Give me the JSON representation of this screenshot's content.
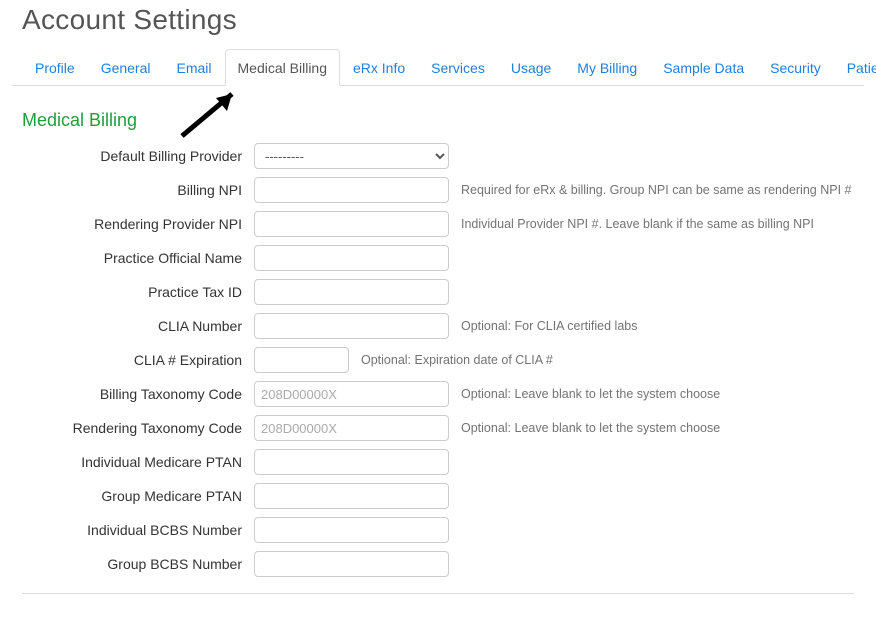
{
  "header": {
    "title": "Account Settings"
  },
  "tabs": [
    {
      "label": "Profile",
      "active": false
    },
    {
      "label": "General",
      "active": false
    },
    {
      "label": "Email",
      "active": false
    },
    {
      "label": "Medical Billing",
      "active": true
    },
    {
      "label": "eRx Info",
      "active": false
    },
    {
      "label": "Services",
      "active": false
    },
    {
      "label": "Usage",
      "active": false
    },
    {
      "label": "My Billing",
      "active": false
    },
    {
      "label": "Sample Data",
      "active": false
    },
    {
      "label": "Security",
      "active": false
    },
    {
      "label": "Patient Payments",
      "active": false
    }
  ],
  "section": {
    "title": "Medical Billing"
  },
  "form": {
    "default_billing_provider": {
      "label": "Default Billing Provider",
      "selected": "---------"
    },
    "billing_npi": {
      "label": "Billing NPI",
      "value": "",
      "help": "Required for eRx & billing. Group NPI can be same as rendering NPI #"
    },
    "rendering_provider_npi": {
      "label": "Rendering Provider NPI",
      "value": "",
      "help": "Individual Provider NPI #. Leave blank if the same as billing NPI"
    },
    "practice_official_name": {
      "label": "Practice Official Name",
      "value": ""
    },
    "practice_tax_id": {
      "label": "Practice Tax ID",
      "value": ""
    },
    "clia_number": {
      "label": "CLIA Number",
      "value": "",
      "help": "Optional: For CLIA certified labs"
    },
    "clia_expiration": {
      "label": "CLIA # Expiration",
      "value": "",
      "help": "Optional: Expiration date of CLIA #"
    },
    "billing_taxonomy_code": {
      "label": "Billing Taxonomy Code",
      "value": "",
      "placeholder": "208D00000X",
      "help": "Optional: Leave blank to let the system choose"
    },
    "rendering_taxonomy_code": {
      "label": "Rendering Taxonomy Code",
      "value": "",
      "placeholder": "208D00000X",
      "help": "Optional: Leave blank to let the system choose"
    },
    "individual_medicare_ptan": {
      "label": "Individual Medicare PTAN",
      "value": ""
    },
    "group_medicare_ptan": {
      "label": "Group Medicare PTAN",
      "value": ""
    },
    "individual_bcbs_number": {
      "label": "Individual BCBS Number",
      "value": ""
    },
    "group_bcbs_number": {
      "label": "Group BCBS Number",
      "value": ""
    }
  }
}
